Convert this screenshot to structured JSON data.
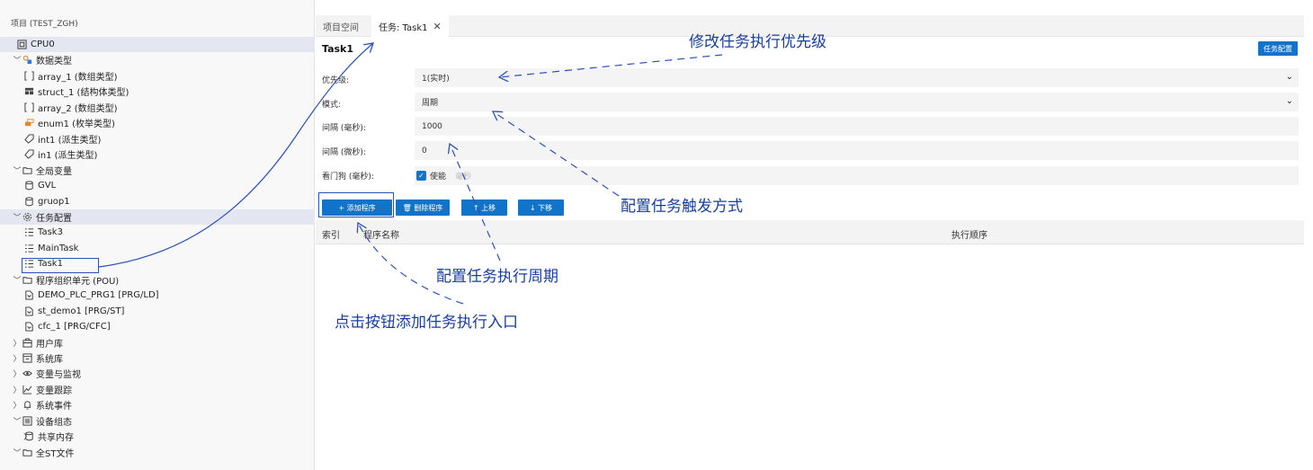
{
  "sidebar": {
    "title": "项目 (TEST_ZGH)",
    "items": [
      {
        "label": "CPU0",
        "icon": "cpu-icon",
        "chev": "",
        "indent": 0,
        "selected": true
      },
      {
        "label": "数据类型",
        "icon": "datatype-icon",
        "chev": "﹀",
        "indent": 1
      },
      {
        "label": "array_1 (数组类型)",
        "icon": "array-icon",
        "chev": "",
        "indent": 2
      },
      {
        "label": "struct_1 (结构体类型)",
        "icon": "struct-icon",
        "chev": "",
        "indent": 2
      },
      {
        "label": "array_2 (数组类型)",
        "icon": "array-icon",
        "chev": "",
        "indent": 2
      },
      {
        "label": "enum1 (枚举类型)",
        "icon": "enum-icon",
        "chev": "",
        "indent": 2
      },
      {
        "label": "int1 (派生类型)",
        "icon": "tag-icon",
        "chev": "",
        "indent": 2
      },
      {
        "label": "in1 (派生类型)",
        "icon": "tag-icon",
        "chev": "",
        "indent": 2
      },
      {
        "label": "全局变量",
        "icon": "folder-icon",
        "chev": "﹀",
        "indent": 1
      },
      {
        "label": "GVL",
        "icon": "database-icon",
        "chev": "",
        "indent": 2
      },
      {
        "label": "gruop1",
        "icon": "database-icon",
        "chev": "",
        "indent": 2
      },
      {
        "label": "任务配置",
        "icon": "gear-icon",
        "chev": "﹀",
        "indent": 1,
        "selected": true
      },
      {
        "label": "Task3",
        "icon": "task-list-icon",
        "chev": "",
        "indent": 2
      },
      {
        "label": "MainTask",
        "icon": "task-list-icon",
        "chev": "",
        "indent": 2
      },
      {
        "label": "Task1",
        "icon": "task-list-icon",
        "chev": "",
        "indent": 2
      },
      {
        "label": "程序组织单元 (POU)",
        "icon": "folder-icon",
        "chev": "﹀",
        "indent": 1
      },
      {
        "label": "DEMO_PLC_PRG1 [PRG/LD]",
        "icon": "program-icon",
        "chev": "",
        "indent": 2
      },
      {
        "label": "st_demo1 [PRG/ST]",
        "icon": "program-icon",
        "chev": "",
        "indent": 2
      },
      {
        "label": "cfc_1 [PRG/CFC]",
        "icon": "program-icon",
        "chev": "",
        "indent": 2
      },
      {
        "label": "用户库",
        "icon": "library-icon",
        "chev": "〉",
        "indent": 1
      },
      {
        "label": "系统库",
        "icon": "system-library-icon",
        "chev": "〉",
        "indent": 1
      },
      {
        "label": "变量与监视",
        "icon": "eye-icon",
        "chev": "〉",
        "indent": 1
      },
      {
        "label": "变量跟踪",
        "icon": "trace-chart-icon",
        "chev": "〉",
        "indent": 1
      },
      {
        "label": "系统事件",
        "icon": "bell-icon",
        "chev": "〉",
        "indent": 1
      },
      {
        "label": "设备组态",
        "icon": "device-icon",
        "chev": "﹀",
        "indent": 1
      },
      {
        "label": "共享内存",
        "icon": "database-icon",
        "chev": "〉",
        "indent": 2
      },
      {
        "label": "全ST文件",
        "icon": "folder-icon",
        "chev": "﹀",
        "indent": 1
      }
    ]
  },
  "tabs": [
    {
      "label": "项目空间",
      "active": false
    },
    {
      "label": "任务: Task1",
      "active": true
    }
  ],
  "tab_close_glyph": "✕",
  "editor": {
    "title": "Task1",
    "config_button": "任务配置",
    "fields": [
      {
        "label": "优先级:",
        "value": "1(实时)",
        "dropdown": true
      },
      {
        "label": "模式:",
        "value": "周期",
        "dropdown": true
      },
      {
        "label": "间隔 (毫秒):",
        "value": "1000",
        "dropdown": false
      },
      {
        "label": "间隔 (微秒):",
        "value": "0",
        "dropdown": false
      }
    ],
    "watchdog": {
      "label": "看门狗 (毫秒):",
      "enable_label": "使能",
      "unit": "毫秒",
      "checked": true
    },
    "buttons": [
      {
        "label": "+ 添加程序",
        "name": "add-program-button"
      },
      {
        "label": "🗑 删除程序",
        "name": "delete-program-button"
      },
      {
        "label": "↑ 上移",
        "name": "move-up-button"
      },
      {
        "label": "↓ 下移",
        "name": "move-down-button"
      }
    ],
    "table_headers": [
      "索引",
      "程序名称",
      "执行顺序"
    ]
  },
  "annotations": [
    "修改任务执行优先级",
    "配置任务触发方式",
    "配置任务执行周期",
    "点击按钮添加任务执行入口"
  ],
  "colors": {
    "accent": "#1174c9",
    "annotation": "#1a3ea0",
    "selected_row": "#e4e6f1"
  }
}
